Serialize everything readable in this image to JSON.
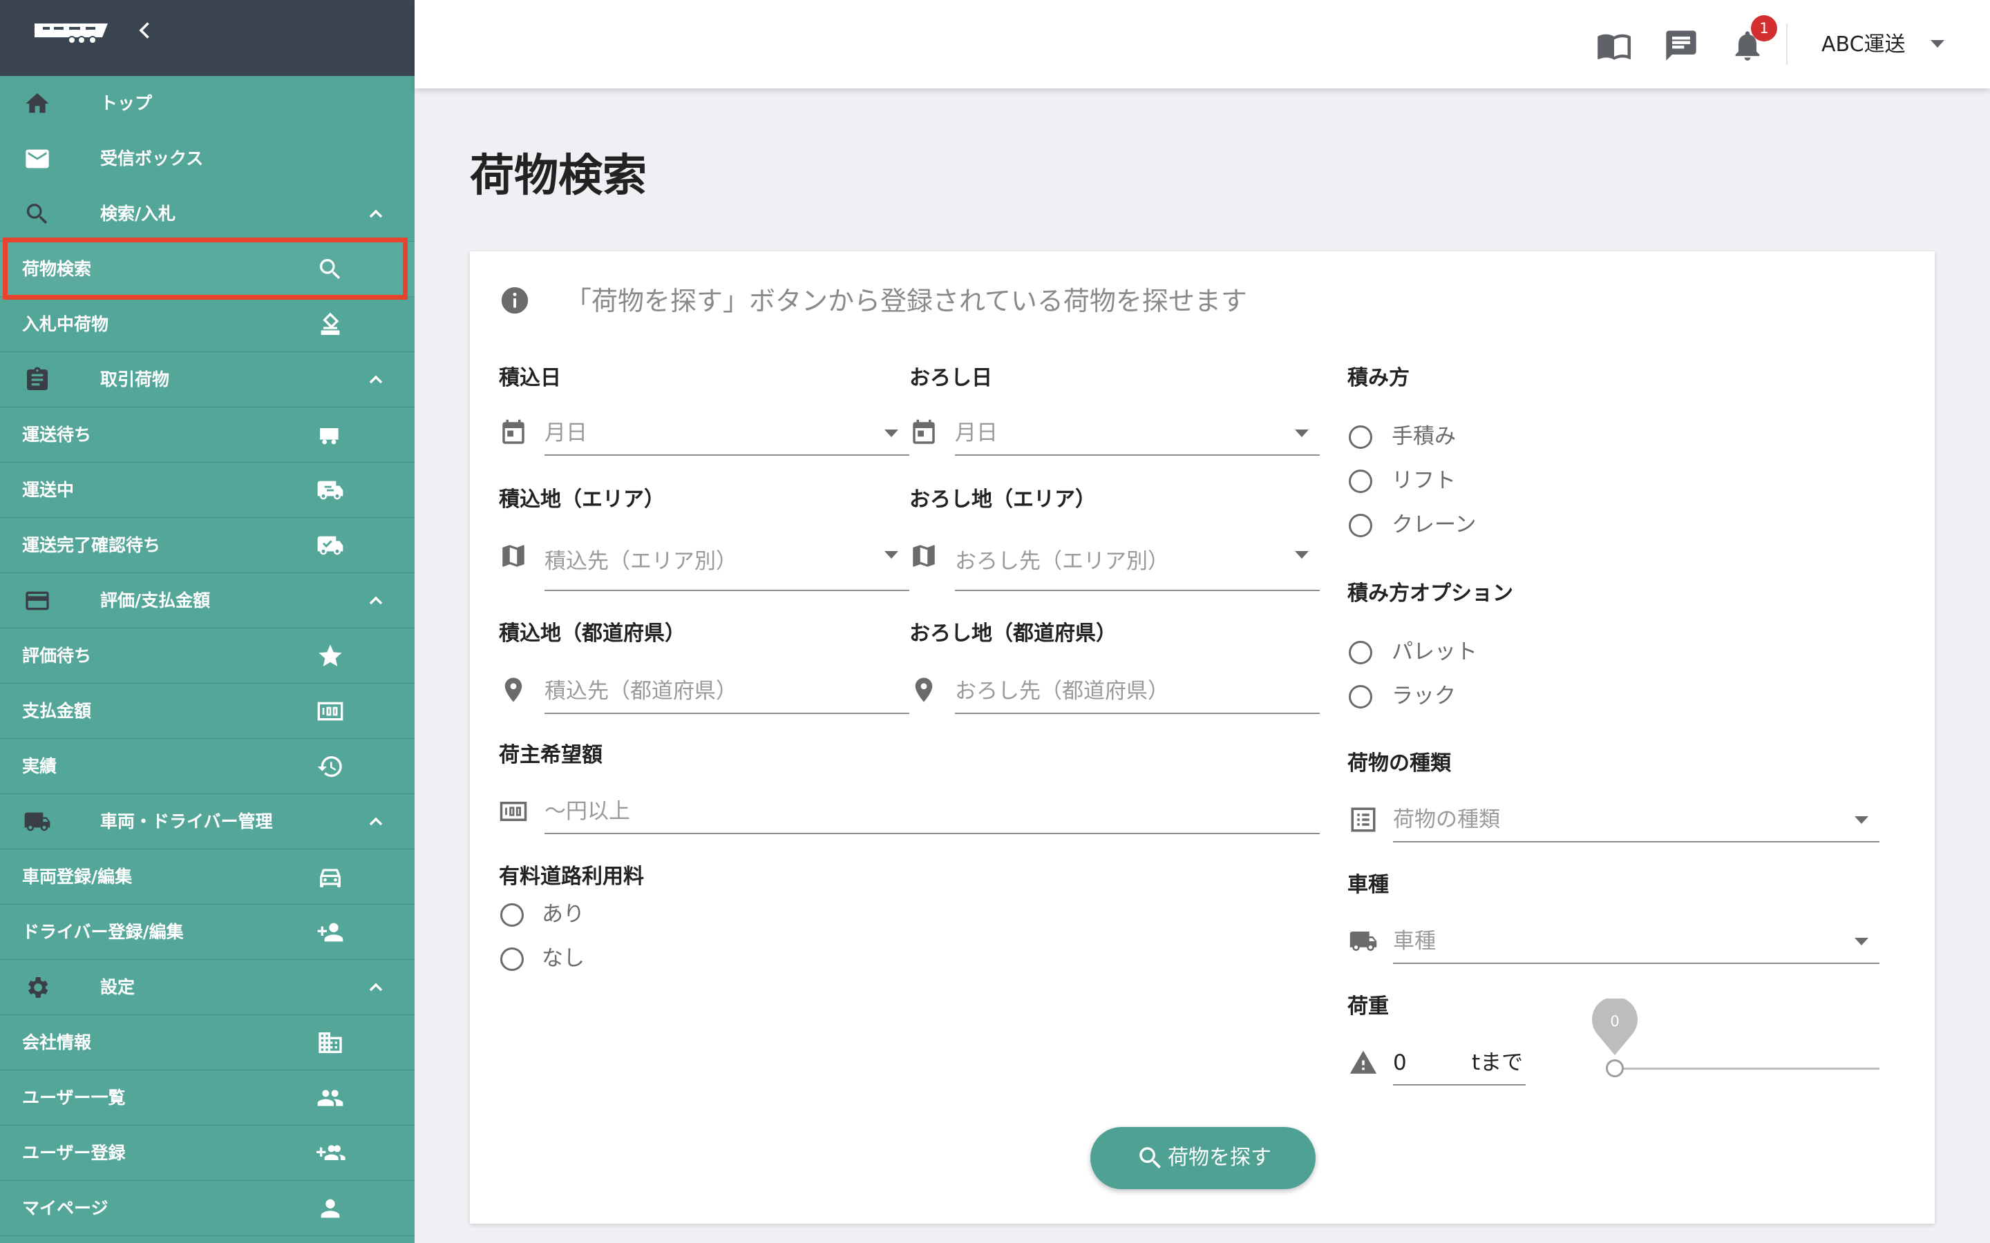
{
  "sidebar": {
    "items": [
      {
        "label": "トップ",
        "icon": "home-icon"
      },
      {
        "label": "受信ボックス",
        "icon": "mail-icon"
      },
      {
        "label": "検索/入札",
        "icon": "search-icon",
        "expanded": true
      },
      {
        "label": "荷物検索",
        "icon": "search-icon",
        "active": true
      },
      {
        "label": "入札中荷物",
        "icon": "bid-icon"
      },
      {
        "label": "取引荷物",
        "icon": "clipboard-icon",
        "expanded": true
      },
      {
        "label": "運送待ち",
        "icon": "truck-waiting-icon"
      },
      {
        "label": "運送中",
        "icon": "truck-moving-icon"
      },
      {
        "label": "運送完了確認待ち",
        "icon": "truck-check-icon"
      },
      {
        "label": "評価/支払金額",
        "icon": "credit-card-icon",
        "expanded": true
      },
      {
        "label": "評価待ち",
        "icon": "star-icon"
      },
      {
        "label": "支払金額",
        "icon": "money-icon"
      },
      {
        "label": "実績",
        "icon": "history-icon"
      },
      {
        "label": "車両・ドライバー管理",
        "icon": "truck-icon",
        "expanded": true
      },
      {
        "label": "車両登録/編集",
        "icon": "car-icon"
      },
      {
        "label": "ドライバー登録/編集",
        "icon": "person-add-icon"
      },
      {
        "label": "設定",
        "icon": "gear-icon",
        "expanded": true
      },
      {
        "label": "会社情報",
        "icon": "building-icon"
      },
      {
        "label": "ユーザー一覧",
        "icon": "people-icon"
      },
      {
        "label": "ユーザー登録",
        "icon": "group-add-icon"
      },
      {
        "label": "マイページ",
        "icon": "person-icon"
      }
    ]
  },
  "header": {
    "company": "ABC運送",
    "notification_count": "1"
  },
  "page": {
    "title": "荷物検索",
    "info": "「荷物を探す」ボタンから登録されている荷物を探せます"
  },
  "form": {
    "load_date": {
      "label": "積込日",
      "placeholder": "月日"
    },
    "unload_date": {
      "label": "おろし日",
      "placeholder": "月日"
    },
    "load_area": {
      "label": "積込地（エリア）",
      "placeholder": "積込先（エリア別）"
    },
    "unload_area": {
      "label": "おろし地（エリア）",
      "placeholder": "おろし先（エリア別）"
    },
    "load_pref": {
      "label": "積込地（都道府県）",
      "placeholder": "積込先（都道府県）"
    },
    "unload_pref": {
      "label": "おろし地（都道府県）",
      "placeholder": "おろし先（都道府県）"
    },
    "price": {
      "label": "荷主希望額",
      "placeholder": "〜円以上"
    },
    "toll": {
      "label": "有料道路利用料",
      "options": [
        "あり",
        "なし"
      ]
    },
    "loading_method": {
      "label": "積み方",
      "options": [
        "手積み",
        "リフト",
        "クレーン"
      ]
    },
    "loading_option": {
      "label": "積み方オプション",
      "options": [
        "パレット",
        "ラック"
      ]
    },
    "cargo_type": {
      "label": "荷物の種類",
      "placeholder": "荷物の種類"
    },
    "vehicle_type": {
      "label": "車種",
      "placeholder": "車種"
    },
    "weight": {
      "label": "荷重",
      "value": "0",
      "unit": "tまで",
      "slider_value": "0"
    },
    "search_button": "荷物を探す"
  },
  "colors": {
    "sidebar": "#54a699",
    "sidebar_top": "#3b4552",
    "accent_button": "#4fa293",
    "highlight": "#e8432c",
    "badge": "#d32f2f"
  }
}
